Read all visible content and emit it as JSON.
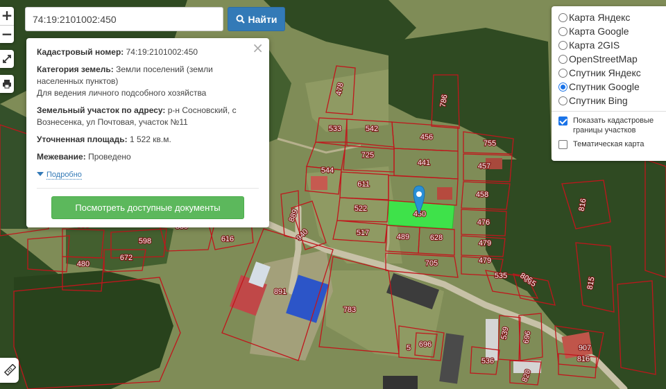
{
  "search": {
    "value": "74:19:2101002:450",
    "button_label": "Найти"
  },
  "zoom": {
    "in": "+",
    "out": "−"
  },
  "popup": {
    "cadastral_label": "Кадастровый номер:",
    "cadastral_value": "74:19:2101002:450",
    "category_label": "Категория земель:",
    "category_value": "Земли поселений (земли населенных пунктов)",
    "use_value": "Для ведения личного подсобного хозяйства",
    "address_label": "Земельный участок по адресу:",
    "address_value": "р-н Сосновский, с Вознесенка, ул Почтовая, участок №11",
    "area_label": "Уточненная площадь:",
    "area_value": "1 522 кв.м.",
    "survey_label": "Межевание:",
    "survey_value": "Проведено",
    "more_link": "Подробно",
    "docs_button": "Посмотреть доступные документы",
    "close": "×"
  },
  "layers": {
    "options": [
      "Карта Яндекс",
      "Карта Google",
      "Карта 2GIS",
      "OpenStreetMap",
      "Спутник Яндекс",
      "Спутник Google",
      "Спутник Bing"
    ],
    "selected": "Спутник Google",
    "show_boundaries": "Показать кадастровые границы участков",
    "show_boundaries_checked": true,
    "thematic_map": "Тематическая карта",
    "thematic_map_checked": false
  },
  "parcel_labels": [
    "478",
    "786",
    "533",
    "542",
    "456",
    "755",
    "725",
    "441",
    "457",
    "544",
    "611",
    "458",
    "522",
    "450",
    "476",
    "517",
    "489",
    "628",
    "479",
    "479",
    "705",
    "535",
    "535",
    "806",
    "889",
    "940",
    "616",
    "598",
    "598",
    "672",
    "480",
    "889",
    "891",
    "783",
    "5",
    "696",
    "536",
    "539",
    "696",
    "820",
    "907",
    "816",
    "816",
    "815"
  ],
  "colors": {
    "parcel_border": "#c0161c",
    "selected_parcel": "#3ee24a",
    "marker": "#2a8fd6",
    "find_button": "#337ab7",
    "docs_button": "#5cb85c"
  },
  "icons": [
    "fullscreen-icon",
    "print-icon",
    "ruler-icon",
    "search-icon",
    "map-marker-icon"
  ]
}
